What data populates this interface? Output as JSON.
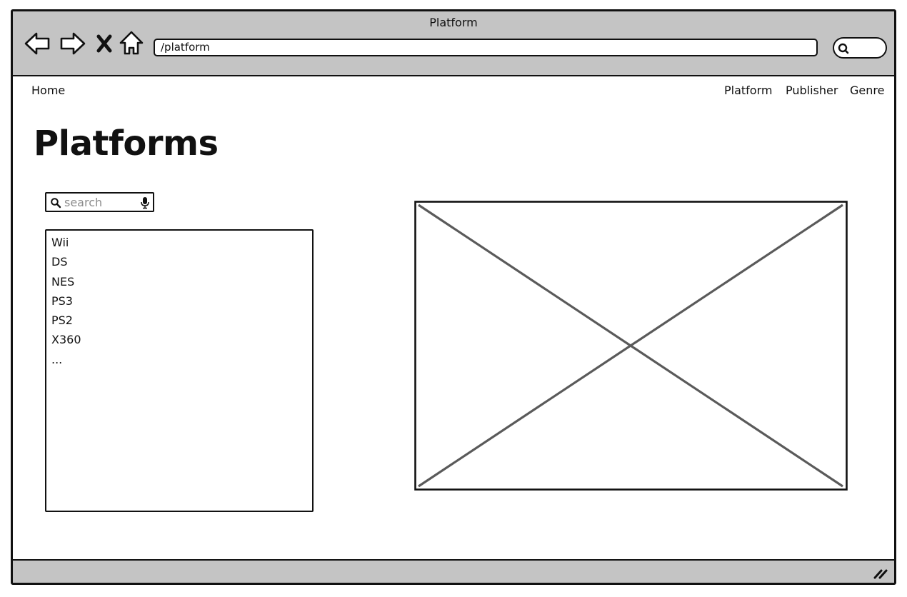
{
  "window": {
    "title": "Platform"
  },
  "browser": {
    "url": "/platform",
    "icons": [
      "back-arrow-icon",
      "forward-arrow-icon",
      "stop-icon",
      "home-icon",
      "search-icon"
    ]
  },
  "menu": {
    "home": "Home",
    "items": [
      "Platform",
      "Publisher",
      "Genre"
    ]
  },
  "page": {
    "heading": "Platforms"
  },
  "search": {
    "placeholder": "search",
    "value": ""
  },
  "platform_list": {
    "items": [
      "Wii",
      "DS",
      "NES",
      "PS3",
      "PS2",
      "X360",
      "..."
    ]
  },
  "colors": {
    "chrome": "#c4c4c4",
    "border": "#111111",
    "placeholder_lines": "#5a5a5a",
    "placeholder_text": "#8c8c8c"
  }
}
